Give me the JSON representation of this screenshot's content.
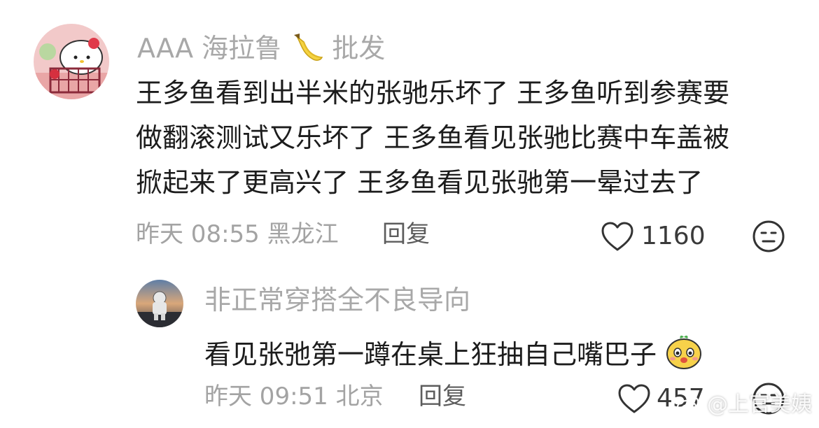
{
  "comments": [
    {
      "username": "AAA 海拉鲁",
      "username_suffix": "批发",
      "username_emoji": "banana",
      "lines": [
        "王多鱼看到出半米的张驰乐坏了 王多鱼听到参赛要",
        "做翻滚测试又乐坏了 王多鱼看见张驰比赛中车盖被",
        "掀起来了更高兴了 王多鱼看见张驰第一晕过去了"
      ],
      "time": "昨天 08:55",
      "location": "黑龙江",
      "reply_label": "回复",
      "likes": "1160"
    },
    {
      "username": "非正常穿搭全不良导向",
      "text": "看见张弛第一蹲在桌上狂抽自己嘴巴子",
      "text_emoji": "cute-face",
      "time": "昨天 09:51",
      "location": "北京",
      "reply_label": "回复",
      "likes": "457"
    }
  ],
  "watermark": {
    "prefix": "@",
    "name": "上官美姨"
  },
  "colors": {
    "username": "#a8a8a8",
    "meta": "#a3a3a3",
    "icon": "#333333"
  }
}
